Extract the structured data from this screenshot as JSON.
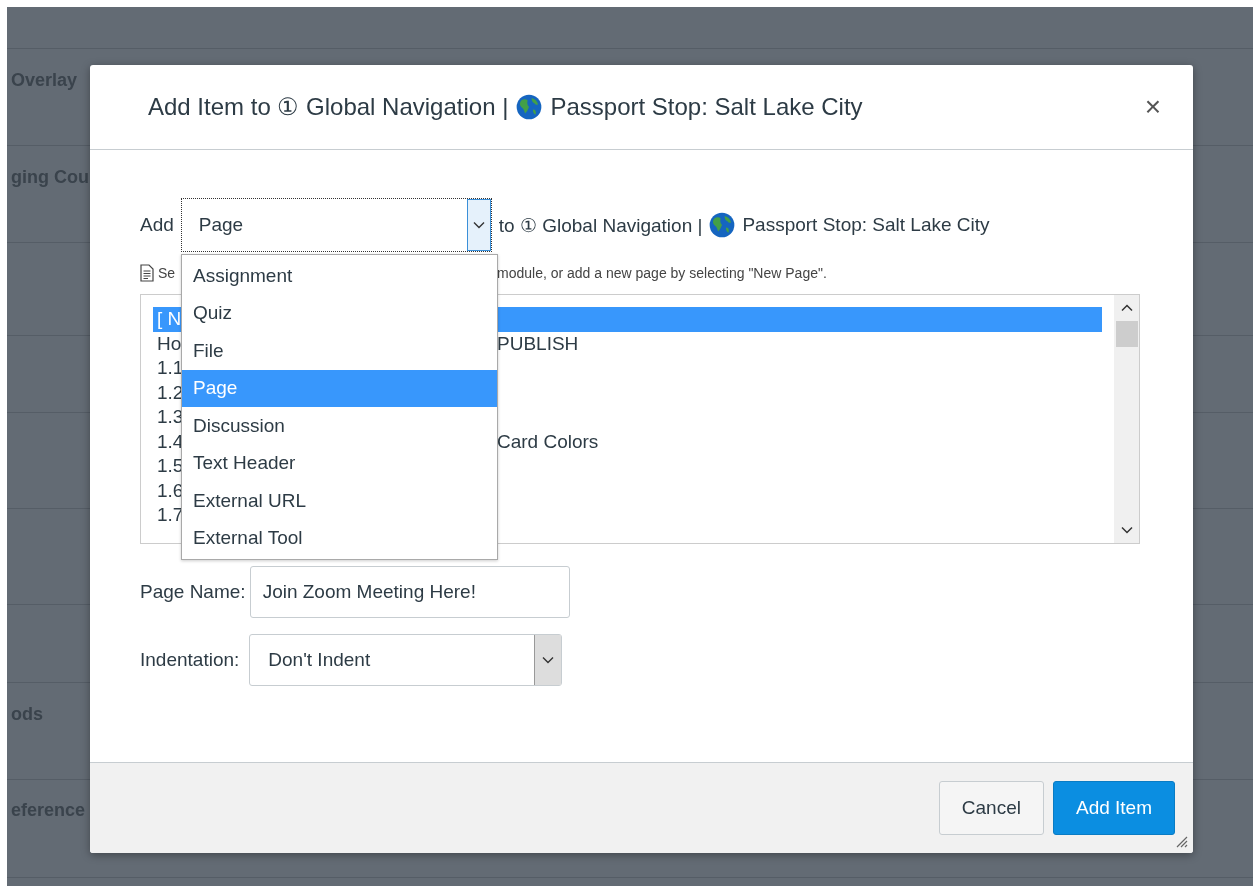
{
  "background_rows": [
    {
      "label": "Overlay"
    },
    {
      "label": "ging Cou"
    },
    {
      "label": "ods"
    },
    {
      "label": "eference"
    }
  ],
  "dialog": {
    "title": "Add Item to ① Global Navigation |",
    "title_course": "Passport Stop: Salt Lake City",
    "close": "×"
  },
  "add_row": {
    "label": "Add",
    "type_value": "Page",
    "target": "to ① Global Navigation |",
    "target_course": "Passport Stop: Salt Lake City"
  },
  "hint": {
    "start": "Se",
    "end": "module, or add a new page by selecting \"New Page\"."
  },
  "item_list": [
    {
      "start": "[ N",
      "selected": true
    },
    {
      "start": "Ho",
      "end": "PUBLISH",
      "selected": false
    },
    {
      "start": "1.1",
      "selected": false
    },
    {
      "start": "1.2",
      "selected": false
    },
    {
      "start": "1.3",
      "selected": false
    },
    {
      "start": "1.4",
      "end": "Card Colors",
      "selected": false
    },
    {
      "start": "1.5",
      "selected": false
    },
    {
      "start": "1.6",
      "selected": false
    },
    {
      "start": "1.7",
      "selected": false
    }
  ],
  "type_menu": [
    {
      "label": "Assignment",
      "selected": false
    },
    {
      "label": "Quiz",
      "selected": false
    },
    {
      "label": "File",
      "selected": false
    },
    {
      "label": "Page",
      "selected": true
    },
    {
      "label": "Discussion",
      "selected": false
    },
    {
      "label": "Text Header",
      "selected": false
    },
    {
      "label": "External URL",
      "selected": false
    },
    {
      "label": "External Tool",
      "selected": false
    }
  ],
  "page_name": {
    "label": "Page Name:",
    "value": "Join Zoom Meeting Here!"
  },
  "indentation": {
    "label": "Indentation:",
    "value": "Don't Indent"
  },
  "buttons": [
    {
      "label": "Cancel",
      "kind": "secondary"
    },
    {
      "label": "Add Item",
      "kind": "primary"
    }
  ]
}
